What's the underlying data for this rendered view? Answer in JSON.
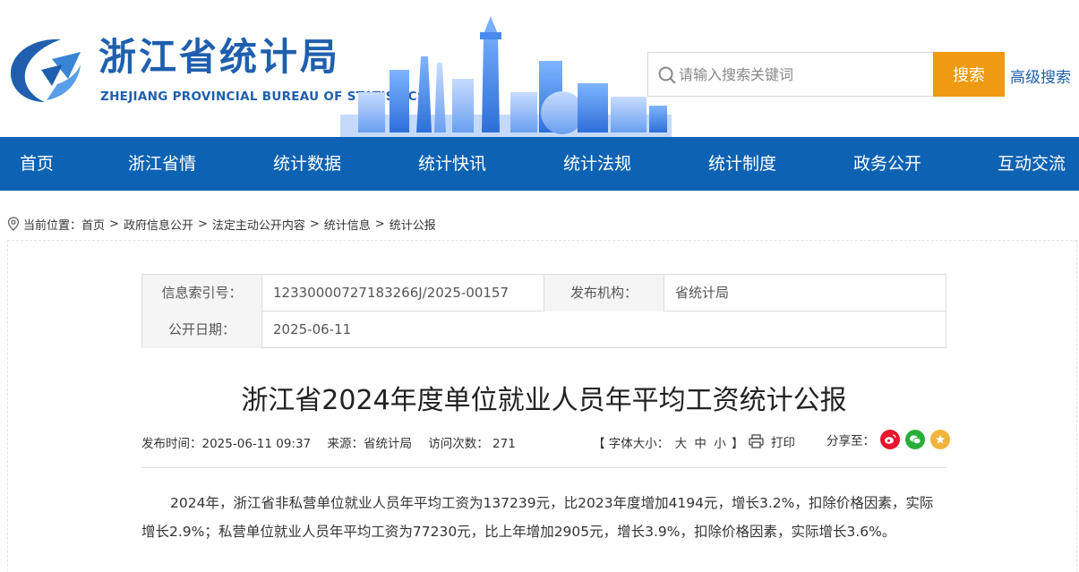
{
  "header": {
    "site_name_cn": "浙江省统计局",
    "site_name_en": "ZHEJIANG PROVINCIAL BUREAU OF STATISTICS",
    "search_placeholder": "请输入搜索关键词",
    "search_button": "搜索",
    "advanced_search": "高级搜索",
    "brand_color": "#1f5fae",
    "search_button_color": "#ef9a10"
  },
  "nav": {
    "color": "#0d62b3",
    "items": [
      "首页",
      "浙江省情",
      "统计数据",
      "统计快讯",
      "统计法规",
      "统计制度",
      "政务公开",
      "互动交流"
    ]
  },
  "breadcrumb": {
    "label": "当前位置：",
    "items": [
      "首页",
      "政府信息公开",
      "法定主动公开内容",
      "统计信息",
      "统计公报"
    ],
    "separator": ">"
  },
  "info": {
    "index_label": "信息索引号：",
    "index_value": "12330000727183266J/2025-00157",
    "publisher_label": "发布机构：",
    "publisher_value": "省统计局",
    "date_label": "公开日期：",
    "date_value": "2025-06-11"
  },
  "article": {
    "title": "浙江省2024年度单位就业人员年平均工资统计公报",
    "meta_time": "发布时间：2025-06-11 09:37",
    "meta_source": "来源：省统计局",
    "meta_visits": "访问次数： 271",
    "font_label": "【 字体大小：",
    "font_large": "大",
    "font_medium": "中",
    "font_small": "小",
    "font_close": "】",
    "print": "打印",
    "share": "分享至：",
    "paragraph": "2024年，浙江省非私营单位就业人员年平均工资为137239元，比2023年度增加4194元，增长3.2%，扣除价格因素，实际增长2.9%；私营单位就业人员年平均工资为77230元，比上年增加2905元，增长3.9%，扣除价格因素，实际增长3.6%。"
  }
}
